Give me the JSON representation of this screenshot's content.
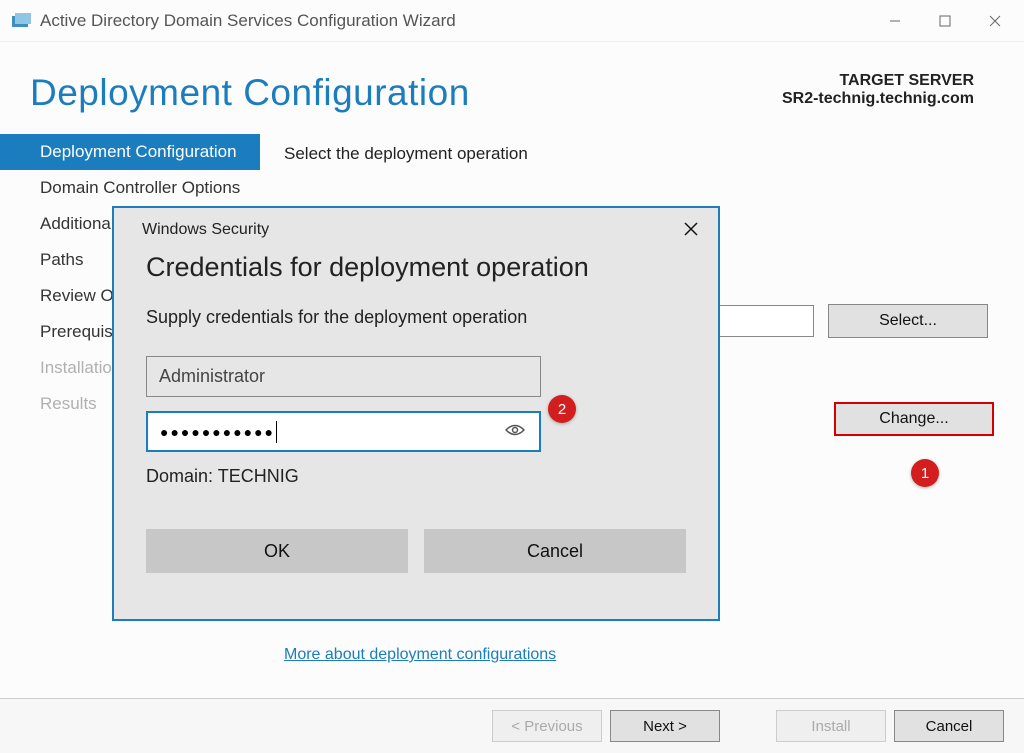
{
  "window": {
    "title": "Active Directory Domain Services Configuration Wizard"
  },
  "header": {
    "page_title": "Deployment Configuration",
    "target_label": "TARGET SERVER",
    "target_name": "SR2-technig.technig.com"
  },
  "sidebar": {
    "items": [
      {
        "label": "Deployment Configuration",
        "active": true
      },
      {
        "label": "Domain Controller Options"
      },
      {
        "label": "Additional Options"
      },
      {
        "label": "Paths"
      },
      {
        "label": "Review Options"
      },
      {
        "label": "Prerequisites Check"
      },
      {
        "label": "Installation",
        "disabled": true
      },
      {
        "label": "Results",
        "disabled": true
      }
    ]
  },
  "content": {
    "instruction": "Select the deployment operation",
    "select_btn": "Select...",
    "change_btn": "Change...",
    "more_link": "More about deployment configurations"
  },
  "footer": {
    "previous": "< Previous",
    "next": "Next >",
    "install": "Install",
    "cancel": "Cancel"
  },
  "modal": {
    "titlebar": "Windows Security",
    "heading": "Credentials for deployment operation",
    "sub": "Supply credentials for the deployment operation",
    "username": "Administrator",
    "password_dots": "●●●●●●●●●●●",
    "domain_line": "Domain: TECHNIG",
    "ok": "OK",
    "cancel": "Cancel"
  },
  "annotations": {
    "b1": "1",
    "b2": "2"
  }
}
